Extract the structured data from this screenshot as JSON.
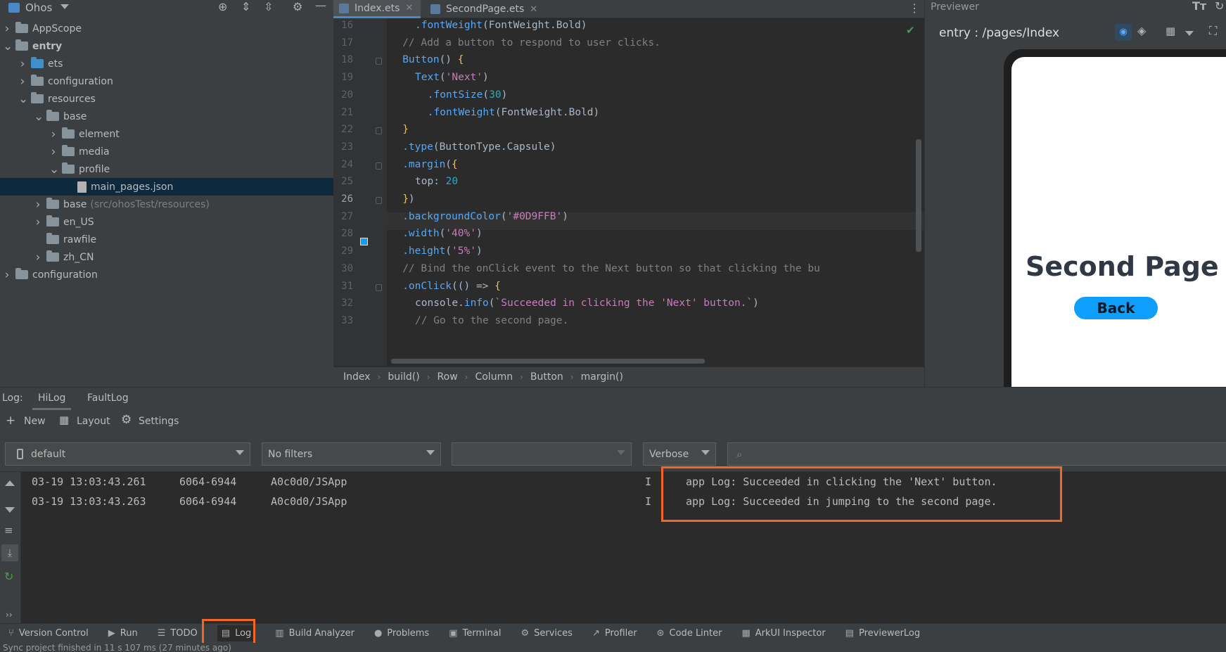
{
  "project": {
    "title": "Ohos",
    "tree": [
      {
        "label": "AppScope",
        "indent": 0,
        "chev": ">",
        "icon": "folder"
      },
      {
        "label": "entry",
        "indent": 0,
        "chev": "v",
        "icon": "folder",
        "bold": true
      },
      {
        "label": "ets",
        "indent": 1,
        "chev": ">",
        "icon": "folder-blue"
      },
      {
        "label": "configuration",
        "indent": 1,
        "chev": ">",
        "icon": "folder"
      },
      {
        "label": "resources",
        "indent": 1,
        "chev": "v",
        "icon": "folder"
      },
      {
        "label": "base",
        "indent": 2,
        "chev": "v",
        "icon": "folder"
      },
      {
        "label": "element",
        "indent": 3,
        "chev": ">",
        "icon": "folder"
      },
      {
        "label": "media",
        "indent": 3,
        "chev": ">",
        "icon": "folder"
      },
      {
        "label": "profile",
        "indent": 3,
        "chev": "v",
        "icon": "folder"
      },
      {
        "label": "main_pages.json",
        "indent": 4,
        "chev": "",
        "icon": "file",
        "selected": true
      },
      {
        "label": "base",
        "indent": 2,
        "chev": ">",
        "icon": "folder",
        "dim": "(src/ohosTest/resources)"
      },
      {
        "label": "en_US",
        "indent": 2,
        "chev": ">",
        "icon": "folder"
      },
      {
        "label": "rawfile",
        "indent": 2,
        "chev": "",
        "icon": "folder"
      },
      {
        "label": "zh_CN",
        "indent": 2,
        "chev": ">",
        "icon": "folder"
      },
      {
        "label": "configuration",
        "indent": 0,
        "chev": ">",
        "icon": "folder"
      }
    ]
  },
  "editor": {
    "tabs": [
      {
        "label": "Index.ets",
        "active": true
      },
      {
        "label": "SecondPage.ets",
        "active": false
      }
    ],
    "lines": [
      {
        "n": "16",
        "indent": 10,
        "segs": [
          [
            ".fontWeight",
            "func"
          ],
          [
            "(FontWeight.Bold)",
            "plain"
          ]
        ]
      },
      {
        "n": "17",
        "indent": 8,
        "segs": [
          [
            "// Add a button to respond to user clicks.",
            "comment"
          ]
        ]
      },
      {
        "n": "18",
        "indent": 8,
        "segs": [
          [
            "Button",
            "func"
          ],
          [
            "() ",
            "plain"
          ],
          [
            "{",
            "yellow"
          ]
        ]
      },
      {
        "n": "19",
        "indent": 10,
        "segs": [
          [
            "Text",
            "func"
          ],
          [
            "(",
            "plain"
          ],
          [
            "'Next'",
            "str"
          ],
          [
            ")",
            "plain"
          ]
        ]
      },
      {
        "n": "20",
        "indent": 12,
        "segs": [
          [
            ".fontSize",
            "func"
          ],
          [
            "(",
            "plain"
          ],
          [
            "30",
            "num"
          ],
          [
            ")",
            "plain"
          ]
        ]
      },
      {
        "n": "21",
        "indent": 12,
        "segs": [
          [
            ".fontWeight",
            "func"
          ],
          [
            "(FontWeight.Bold)",
            "plain"
          ]
        ]
      },
      {
        "n": "22",
        "indent": 8,
        "segs": [
          [
            "}",
            "yellow"
          ]
        ]
      },
      {
        "n": "23",
        "indent": 8,
        "segs": [
          [
            ".type",
            "func"
          ],
          [
            "(ButtonType.Capsule)",
            "plain"
          ]
        ]
      },
      {
        "n": "24",
        "indent": 8,
        "segs": [
          [
            ".margin",
            "func"
          ],
          [
            "(",
            "plain"
          ],
          [
            "{",
            "yellow"
          ]
        ]
      },
      {
        "n": "25",
        "indent": 10,
        "segs": [
          [
            "top",
            "plain"
          ],
          [
            ": ",
            "plain"
          ],
          [
            "20",
            "num"
          ]
        ]
      },
      {
        "n": "26",
        "indent": 8,
        "segs": [
          [
            "}",
            "yellow"
          ],
          [
            ")",
            "plain"
          ]
        ]
      },
      {
        "n": "27",
        "indent": 8,
        "segs": [
          [
            ".backgroundColor",
            "func"
          ],
          [
            "(",
            "plain"
          ],
          [
            "'#0D9FFB'",
            "str"
          ],
          [
            ")",
            "plain"
          ]
        ]
      },
      {
        "n": "28",
        "indent": 8,
        "segs": [
          [
            ".width",
            "func"
          ],
          [
            "(",
            "plain"
          ],
          [
            "'40%'",
            "str"
          ],
          [
            ")",
            "plain"
          ]
        ]
      },
      {
        "n": "29",
        "indent": 8,
        "segs": [
          [
            ".height",
            "func"
          ],
          [
            "(",
            "plain"
          ],
          [
            "'5%'",
            "str"
          ],
          [
            ")",
            "plain"
          ]
        ]
      },
      {
        "n": "30",
        "indent": 8,
        "segs": [
          [
            "// Bind the onClick event to the Next button so that clicking the bu",
            "comment"
          ]
        ]
      },
      {
        "n": "31",
        "indent": 8,
        "segs": [
          [
            ".onClick",
            "func"
          ],
          [
            "(() => ",
            "plain"
          ],
          [
            "{",
            "yellow"
          ]
        ]
      },
      {
        "n": "32",
        "indent": 10,
        "segs": [
          [
            "console",
            "plain"
          ],
          [
            ".",
            "plain"
          ],
          [
            "info",
            "func"
          ],
          [
            "(",
            "plain"
          ],
          [
            "`Succeeded in clicking the 'Next' button.`",
            "str"
          ],
          [
            ")",
            "plain"
          ]
        ]
      },
      {
        "n": "33",
        "indent": 10,
        "segs": [
          [
            "// Go to the second page.",
            "comment"
          ]
        ]
      }
    ],
    "current_line": "26",
    "breadcrumbs": [
      "Index",
      "build()",
      "Row",
      "Column",
      "Button",
      "margin()"
    ]
  },
  "previewer": {
    "title": "Previewer",
    "route": "entry : /pages/Index",
    "page_heading": "Second Page",
    "back_label": "Back",
    "accent": "#0d9ffb"
  },
  "log": {
    "label": "Log:",
    "tabs": [
      "HiLog",
      "FaultLog"
    ],
    "toolbar": [
      "New",
      "Layout",
      "Settings"
    ],
    "device": "default",
    "filter": "No filters",
    "process": "",
    "level": "Verbose",
    "search_placeholder": "",
    "entries": [
      {
        "time": "03-19 13:03:43.261",
        "pid": "6064-6944",
        "tag": "A0c0d0/JSApp",
        "level": "I",
        "msg": "app Log: Succeeded in clicking the 'Next' button."
      },
      {
        "time": "03-19 13:03:43.263",
        "pid": "6064-6944",
        "tag": "A0c0d0/JSApp",
        "level": "I",
        "msg": "app Log: Succeeded in jumping to the second page."
      }
    ],
    "highlight_color": "#f26522"
  },
  "bottom_bar": {
    "items": [
      {
        "label": "Version Control",
        "icon": "branch-icon"
      },
      {
        "label": "Run",
        "icon": "run-icon"
      },
      {
        "label": "TODO",
        "icon": "todo-icon"
      },
      {
        "label": "Log",
        "icon": "log-icon",
        "active": true
      },
      {
        "label": "Build Analyzer",
        "icon": "build-analyzer-icon"
      },
      {
        "label": "Problems",
        "icon": "problems-icon"
      },
      {
        "label": "Terminal",
        "icon": "terminal-icon"
      },
      {
        "label": "Services",
        "icon": "services-icon"
      },
      {
        "label": "Profiler",
        "icon": "profiler-icon"
      },
      {
        "label": "Code Linter",
        "icon": "code-linter-icon"
      },
      {
        "label": "ArkUI Inspector",
        "icon": "inspector-icon"
      },
      {
        "label": "PreviewerLog",
        "icon": "previewer-log-icon"
      }
    ],
    "status": "Sync project finished in 11 s 107 ms (27 minutes ago)"
  }
}
